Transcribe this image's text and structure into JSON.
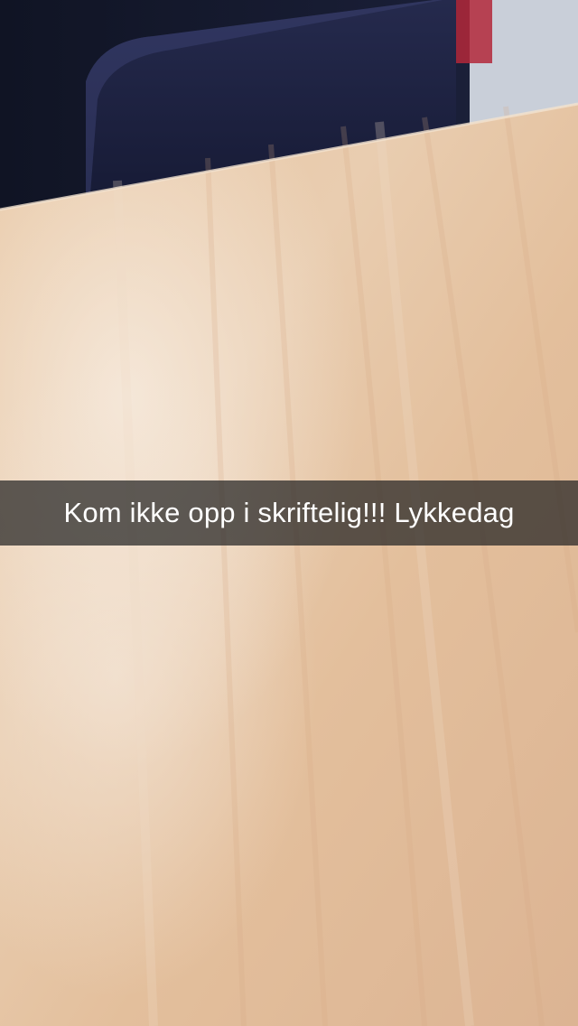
{
  "caption": {
    "text": "Kom ikke opp i skriftelig!!! Lykkedag"
  },
  "scene": {
    "subject": "wooden-table-surface",
    "background_subject": "dark-chair-and-person"
  },
  "colors": {
    "wood_light": "#f1dcc6",
    "wood_mid": "#e6c3a0",
    "wood_dark": "#d8ae88",
    "chair": "#1c2140",
    "clothing": "#141828",
    "wall": "#c9cfd9",
    "caption_bg": "#232323",
    "caption_text": "#ffffff"
  }
}
